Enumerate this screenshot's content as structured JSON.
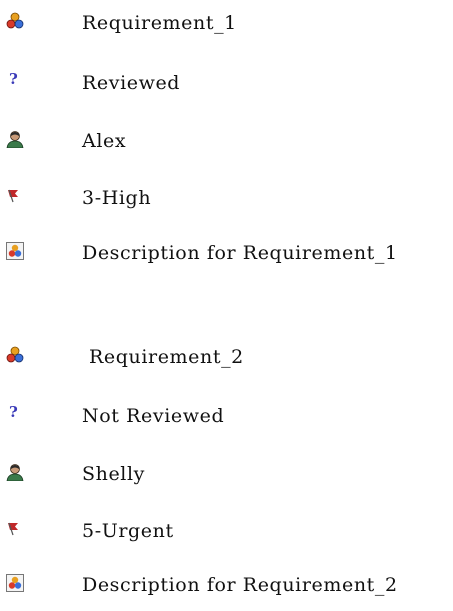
{
  "requirements": [
    {
      "name": "Requirement_1",
      "status": "Reviewed",
      "owner": "Alex",
      "priority": "3-High",
      "description": "Description for Requirement_1"
    },
    {
      "name": "Requirement_2",
      "status": "Not Reviewed",
      "owner": "Shelly",
      "priority": "5-Urgent",
      "description": "Description for Requirement_2"
    }
  ],
  "icons": {
    "requirement": "requirement-icon",
    "status": "question-mark-icon",
    "owner": "user-icon",
    "priority": "flag-icon",
    "description": "description-icon"
  },
  "colors": {
    "requirement_red": "#d83a2a",
    "requirement_blue": "#3a6fd8",
    "requirement_orange": "#e8a020",
    "question_blue": "#3a3ab8",
    "flag_red": "#c0282a"
  }
}
